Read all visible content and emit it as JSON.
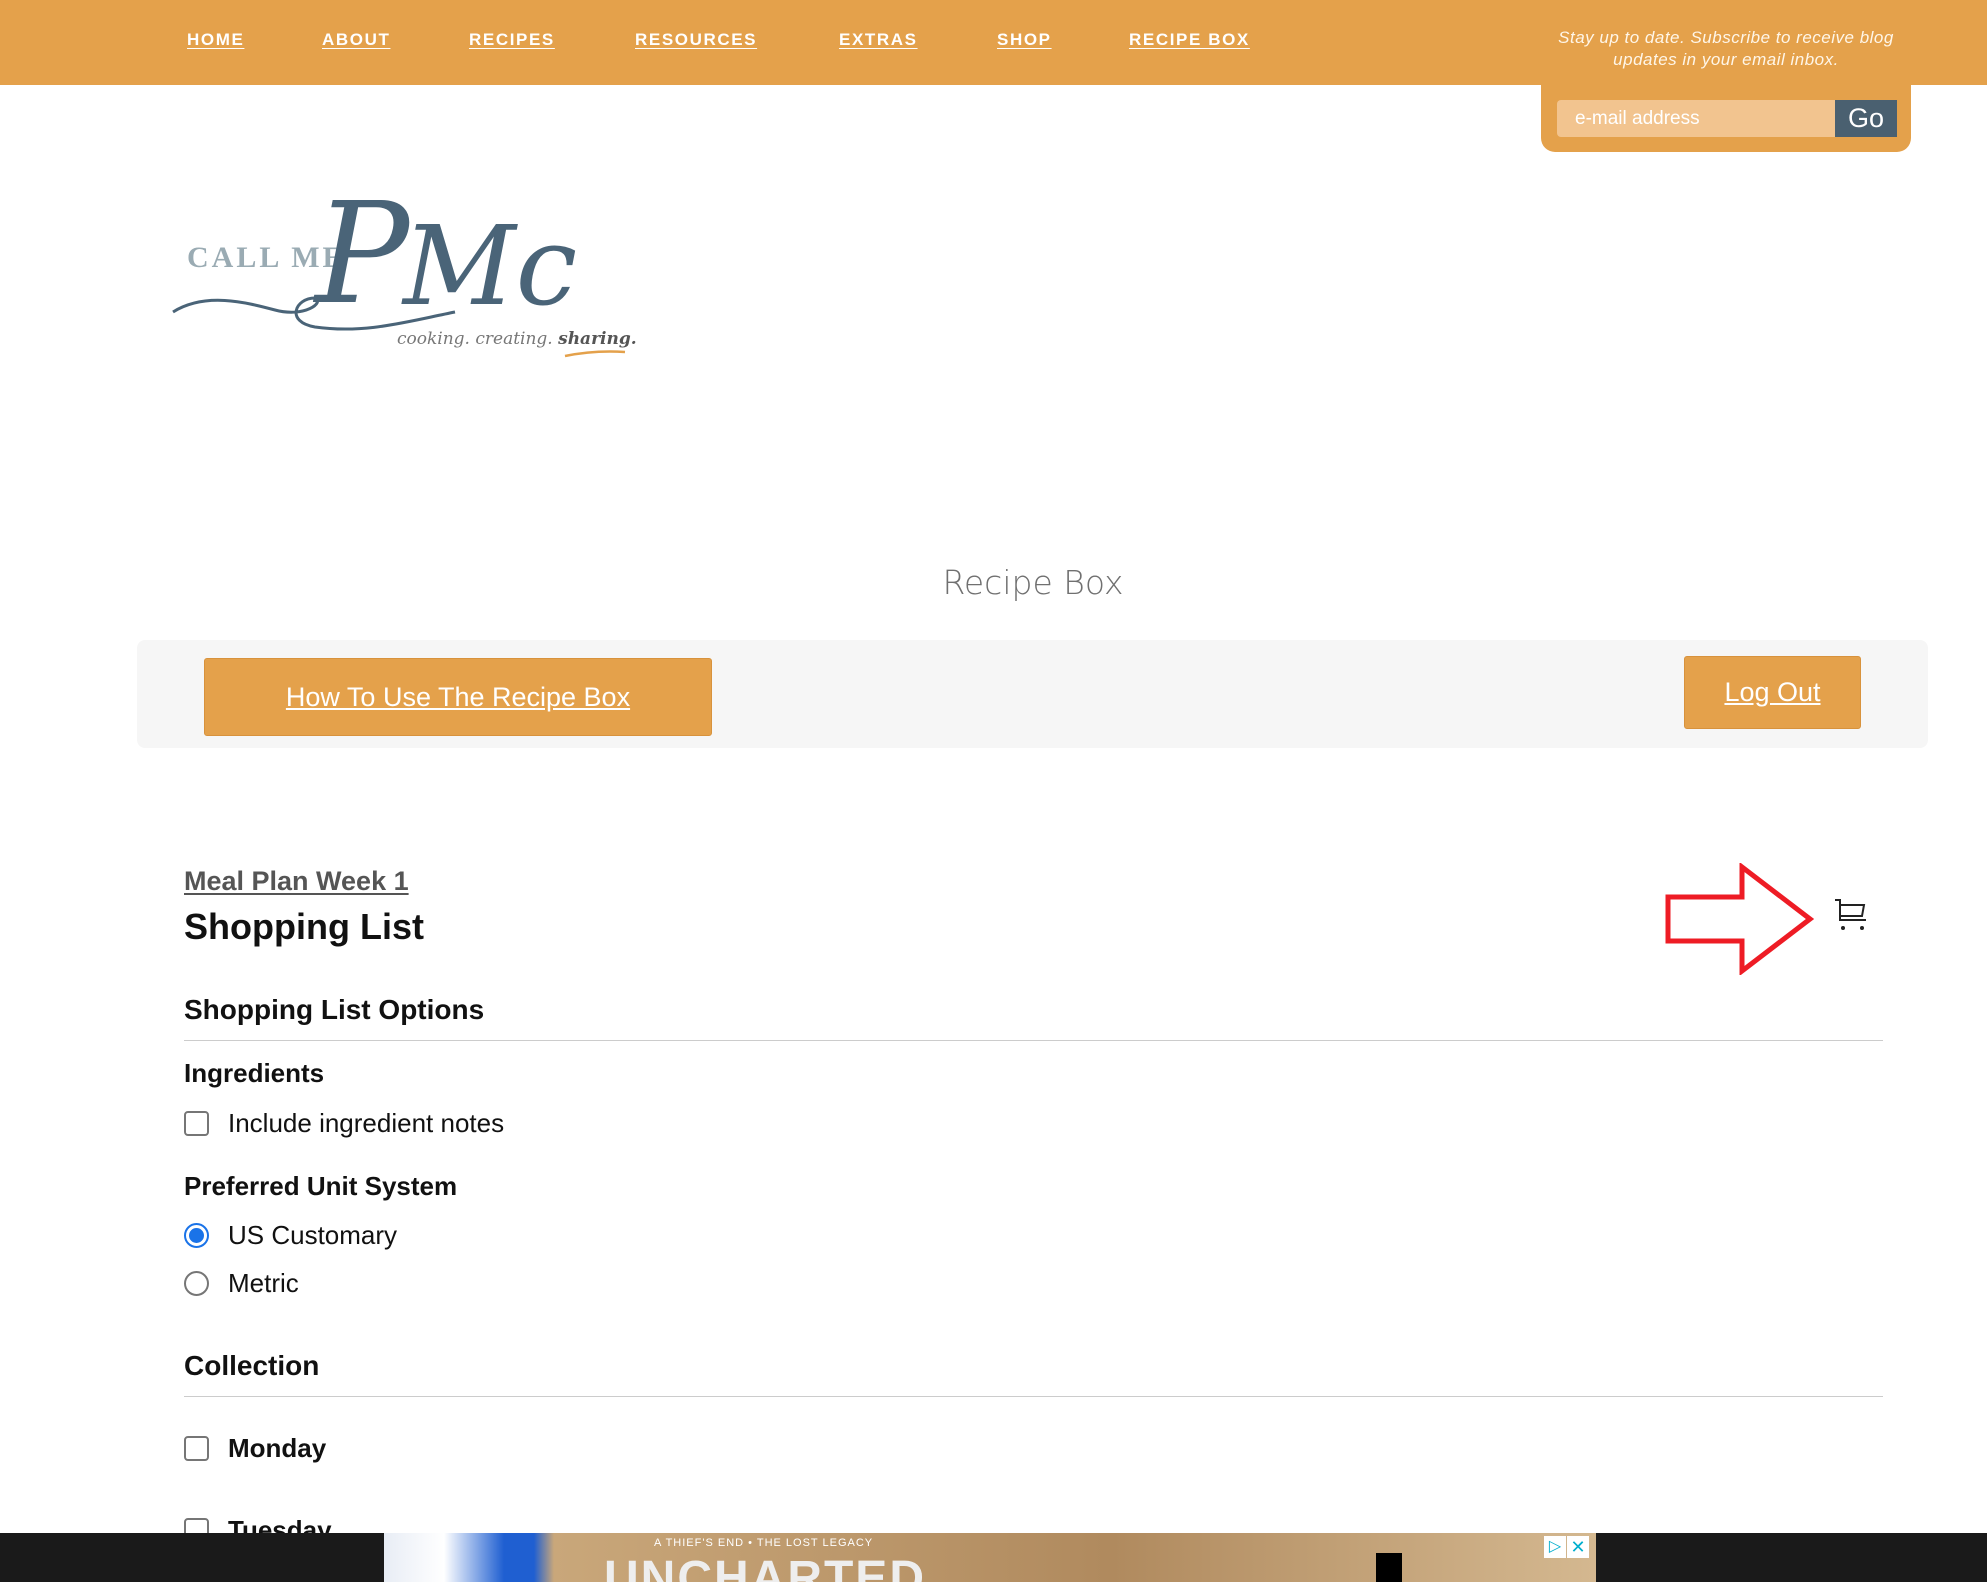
{
  "nav": {
    "items": [
      "HOME",
      "ABOUT",
      "RECIPES",
      "RESOURCES",
      "EXTRAS",
      "SHOP",
      "RECIPE BOX"
    ]
  },
  "subscribe": {
    "text": "Stay up to date. Subscribe to receive blog updates in your email inbox.",
    "placeholder": "e-mail address",
    "go_label": "Go"
  },
  "logo": {
    "text": "CALL ME PMc",
    "tagline": "cooking. creating. sharing."
  },
  "page_title": "Recipe Box",
  "toolbar": {
    "how_to_label": "How To Use The Recipe Box",
    "logout_label": "Log Out"
  },
  "content": {
    "meal_plan_link": "Meal Plan Week 1",
    "title": "Shopping List",
    "options_heading": "Shopping List Options",
    "ingredients_heading": "Ingredients",
    "include_notes_label": "Include ingredient notes",
    "include_notes_checked": false,
    "unit_heading": "Preferred Unit System",
    "units": [
      {
        "label": "US Customary",
        "selected": true
      },
      {
        "label": "Metric",
        "selected": false
      }
    ],
    "collection_heading": "Collection",
    "days": [
      "Monday",
      "Tuesday"
    ]
  },
  "ad": {
    "tagline": "A THIEF'S END  •  THE LOST LEGACY",
    "title": "UNCHARTED"
  },
  "colors": {
    "accent": "#e4a14b",
    "go_button": "#4a6070",
    "annotation_arrow": "#ee1c25",
    "radio": "#1a73e8"
  }
}
